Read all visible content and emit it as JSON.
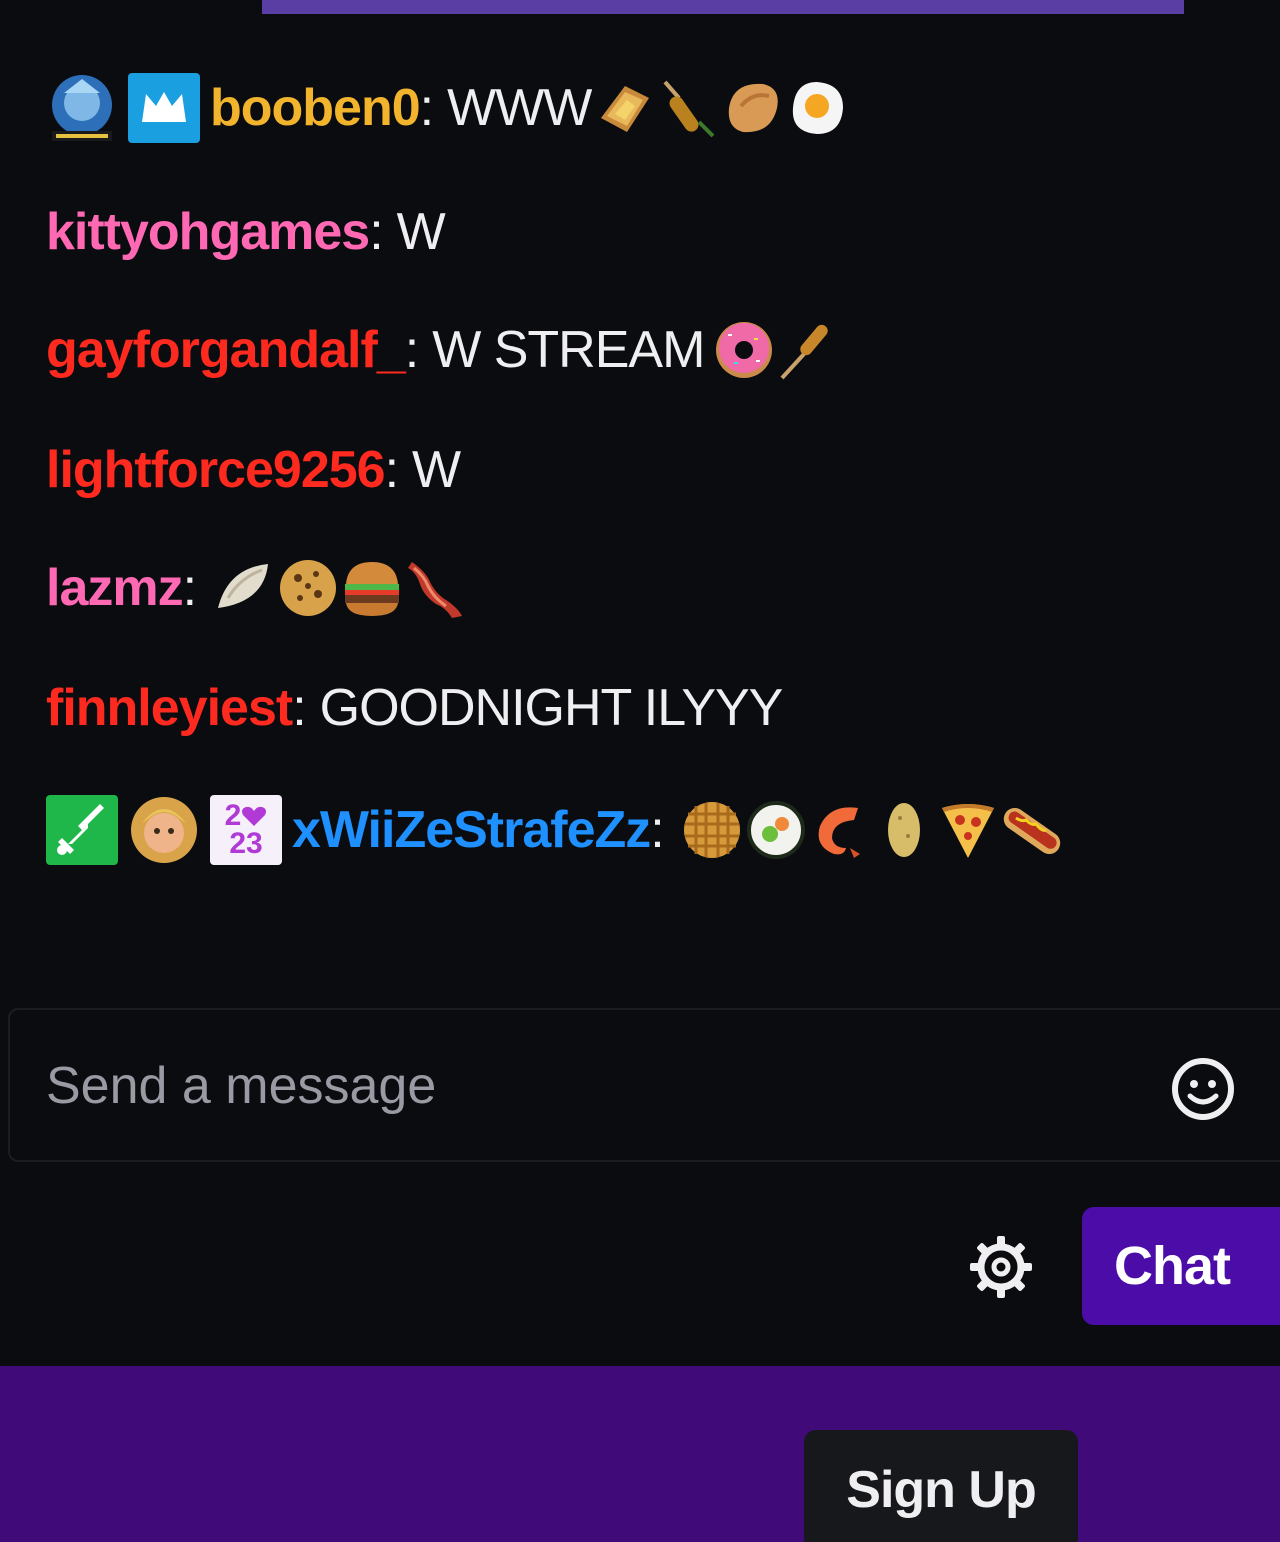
{
  "colors": {
    "background": "#0b0c10",
    "accent_purple": "#4c0ca8",
    "footer_purple": "#400a78",
    "text": "#efeff1"
  },
  "chat": {
    "messages": [
      {
        "username": "booben0",
        "username_color": "#f2b42c",
        "badges": [
          "statue-of-liberty-badge-icon",
          "crown-badge-icon"
        ],
        "text": "WWW",
        "emotes": [
          "grilled-cheese-emote-icon",
          "corn-dog-emote-icon",
          "fortune-cookie-emote-icon",
          "fried-egg-emote-icon"
        ]
      },
      {
        "username": "kittyohgames",
        "username_color": "#ff69b4",
        "badges": [],
        "text": "W",
        "emotes": []
      },
      {
        "username": "gayforgandalf_",
        "username_color": "#ff2a1f",
        "badges": [],
        "text": "W STREAM",
        "emotes": [
          "donut-emote-icon",
          "corn-dog-emote-icon"
        ]
      },
      {
        "username": "lightforce9256",
        "username_color": "#ff2a1f",
        "badges": [],
        "text": "W",
        "emotes": []
      },
      {
        "username": "lazmz",
        "username_color": "#ff69b4",
        "badges": [],
        "text": "",
        "emotes": [
          "dumpling-emote-icon",
          "cookie-emote-icon",
          "burger-emote-icon",
          "bacon-emote-icon"
        ]
      },
      {
        "username": "finnleyiest",
        "username_color": "#ff2a1f",
        "badges": [],
        "text": "GOODNIGHT ILYYY",
        "emotes": []
      },
      {
        "username": "xWiiZeStrafeZz",
        "username_color": "#1e90ff",
        "badges": [
          "sword-badge-icon",
          "character-badge-icon",
          "2023-badge-icon"
        ],
        "text": "",
        "emotes": [
          "waffle-emote-icon",
          "sushi-emote-icon",
          "shrimp-emote-icon",
          "potato-emote-icon",
          "pizza-emote-icon",
          "hotdog-emote-icon"
        ]
      }
    ]
  },
  "badge_labels": {
    "year_top": "2",
    "year_bottom": "23"
  },
  "composer": {
    "placeholder": "Send a message",
    "emoji_icon": "smiley-icon",
    "settings_icon": "gear-icon",
    "chat_button_label": "Chat"
  },
  "footer": {
    "signup_label": "Sign Up"
  }
}
